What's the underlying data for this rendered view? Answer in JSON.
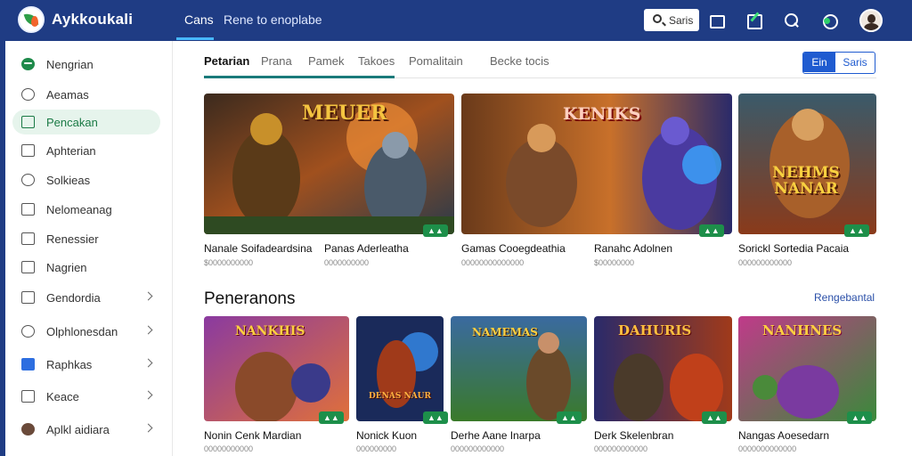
{
  "app": {
    "title": "Aykkoukali"
  },
  "topnav": {
    "tabs": [
      {
        "label": "Cans"
      },
      {
        "label": "Rene to enoplabe"
      }
    ],
    "search_label": "Saris"
  },
  "sidebar": {
    "items": [
      {
        "label": "Nengrian",
        "icon": "brand-icon"
      },
      {
        "label": "Aeamas",
        "icon": "gauge-icon"
      },
      {
        "label": "Pencakan",
        "icon": "chart-icon"
      },
      {
        "label": "Aphterian",
        "icon": "doc-icon"
      },
      {
        "label": "Solkieas",
        "icon": "circle-icon"
      },
      {
        "label": "Nelomeanag",
        "icon": "folder-icon"
      },
      {
        "label": "Renessier",
        "icon": "check-icon"
      },
      {
        "label": "Nagrien",
        "icon": "page-icon"
      },
      {
        "label": "Gendordia",
        "icon": "cube-icon"
      },
      {
        "label": "Olphlonesdan",
        "icon": "globe-icon"
      },
      {
        "label": "Raphkas",
        "icon": "image-icon"
      },
      {
        "label": "Keace",
        "icon": "key-icon"
      },
      {
        "label": "Aplkl aidiara",
        "icon": "user-photo-icon"
      }
    ]
  },
  "content_tabs": [
    {
      "label": "Petarian"
    },
    {
      "label": "Prana"
    },
    {
      "label": "Pamek"
    },
    {
      "label": "Takoes"
    },
    {
      "label": "Pomalitain"
    },
    {
      "label": "Becke tocis"
    }
  ],
  "view_toggle": {
    "a": "Ein",
    "b": "Saris"
  },
  "featured": [
    {
      "title": "Nanale Soifadeardsina",
      "meta": "$0000000000",
      "art": "MEUER"
    },
    {
      "title": "Panas Aderleatha",
      "meta": "0000000000",
      "art": ""
    },
    {
      "title": "Gamas Cooegdeathia",
      "meta": "00000000000000",
      "art": "KENIKS"
    },
    {
      "title": "Ranahc Adolnen",
      "meta": "$00000000",
      "art": ""
    },
    {
      "title": "Sorickl Sortedia Pacaia",
      "meta": "000000000000",
      "art": "NEHMS NANAR"
    }
  ],
  "section": {
    "title": "Peneranons",
    "link": "Rengebantal"
  },
  "recommended": [
    {
      "title": "Nonin Cenk Mardian",
      "meta": "00000000000",
      "art": "NANKHIS"
    },
    {
      "title": "Nonick Kuon",
      "meta": "000000000",
      "art": "DENAS NAUR"
    },
    {
      "title": "Derhe Aane Inarpa",
      "meta": "000000000000",
      "art": "NAMEMAS"
    },
    {
      "title": "Derk Skelenbran",
      "meta": "000000000000",
      "art": "DAHURIS"
    },
    {
      "title": "Nangas Aoesedarn",
      "meta": "0000000000000",
      "art": "NANHNES"
    }
  ]
}
